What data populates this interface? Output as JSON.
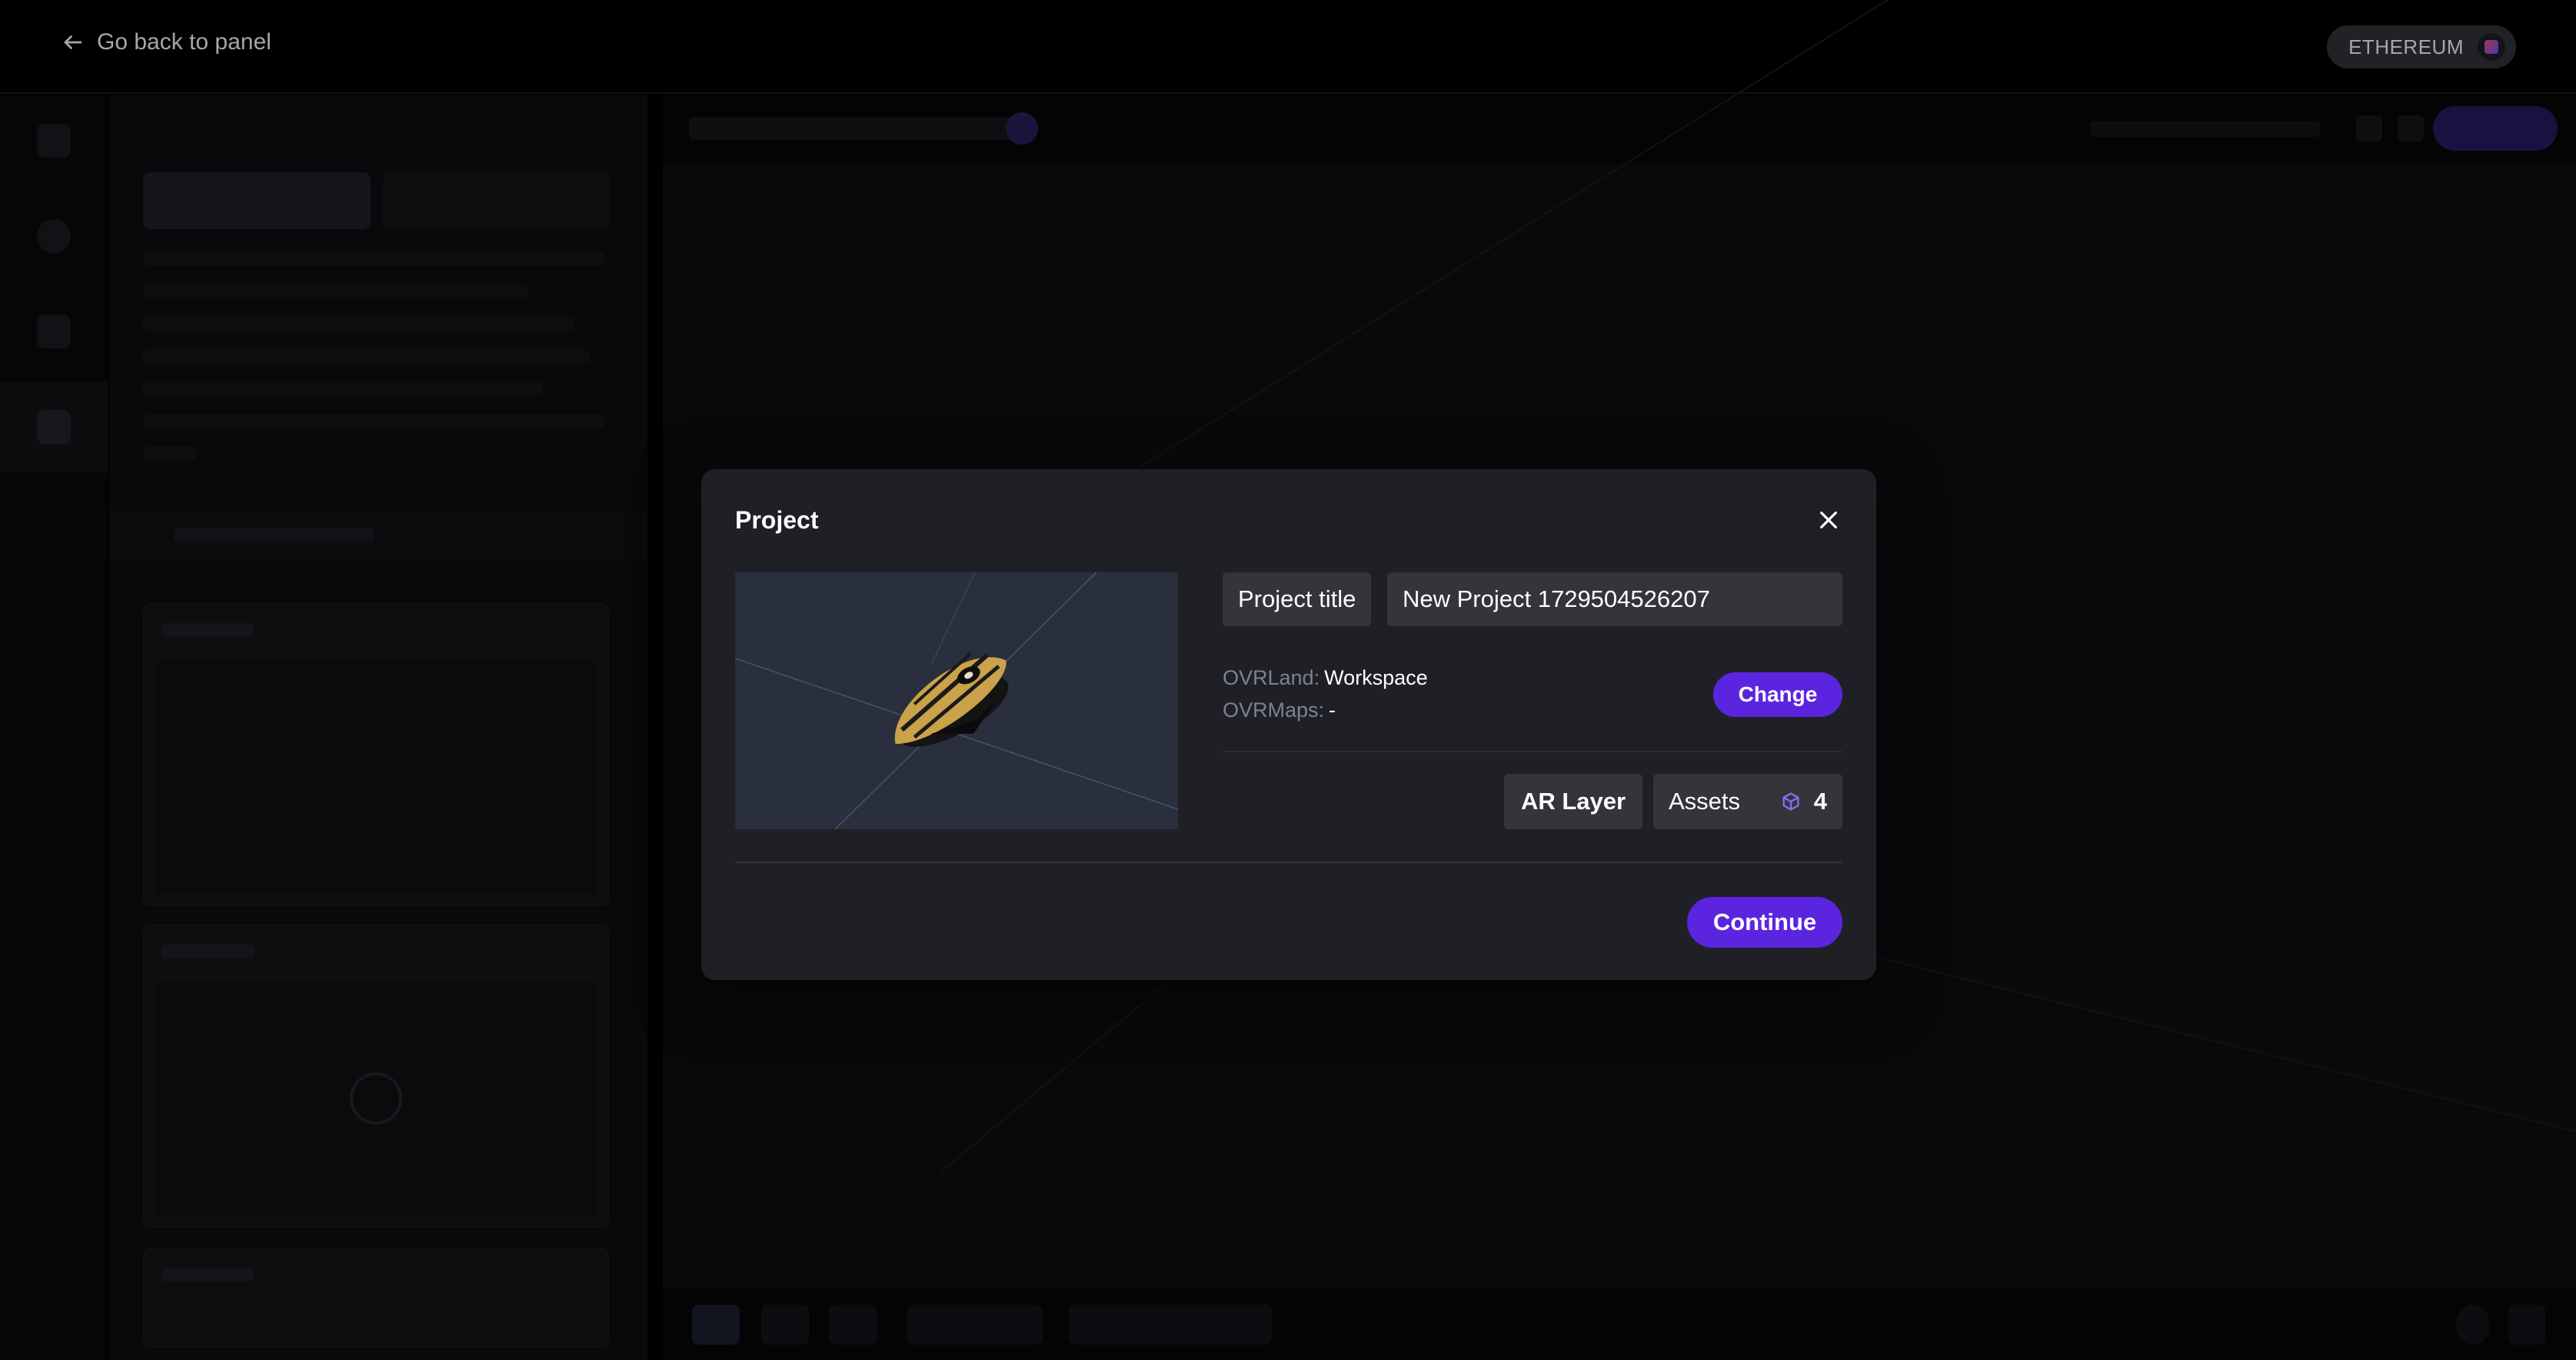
{
  "topbar": {
    "back_label": "Go back to panel",
    "chain_label": "ETHEREUM"
  },
  "modal": {
    "title": "Project",
    "project_title_label": "Project title",
    "project_title_value": "New Project 1729504526207",
    "ovrland_key": "OVRLand:",
    "ovrland_value": "Workspace",
    "ovrmaps_key": "OVRMaps:",
    "ovrmaps_value": "-",
    "change_label": "Change",
    "layer_label": "AR Layer",
    "assets_label": "Assets",
    "assets_count": "4",
    "continue_label": "Continue"
  },
  "colors": {
    "accent": "#5b25e0",
    "modal_bg": "#1f2025",
    "field_bg": "#34353b",
    "muted_text": "#7d8094"
  },
  "icons": [
    "arrow-left-icon",
    "ethereum-chain-icon",
    "close-icon",
    "cube-icon"
  ]
}
